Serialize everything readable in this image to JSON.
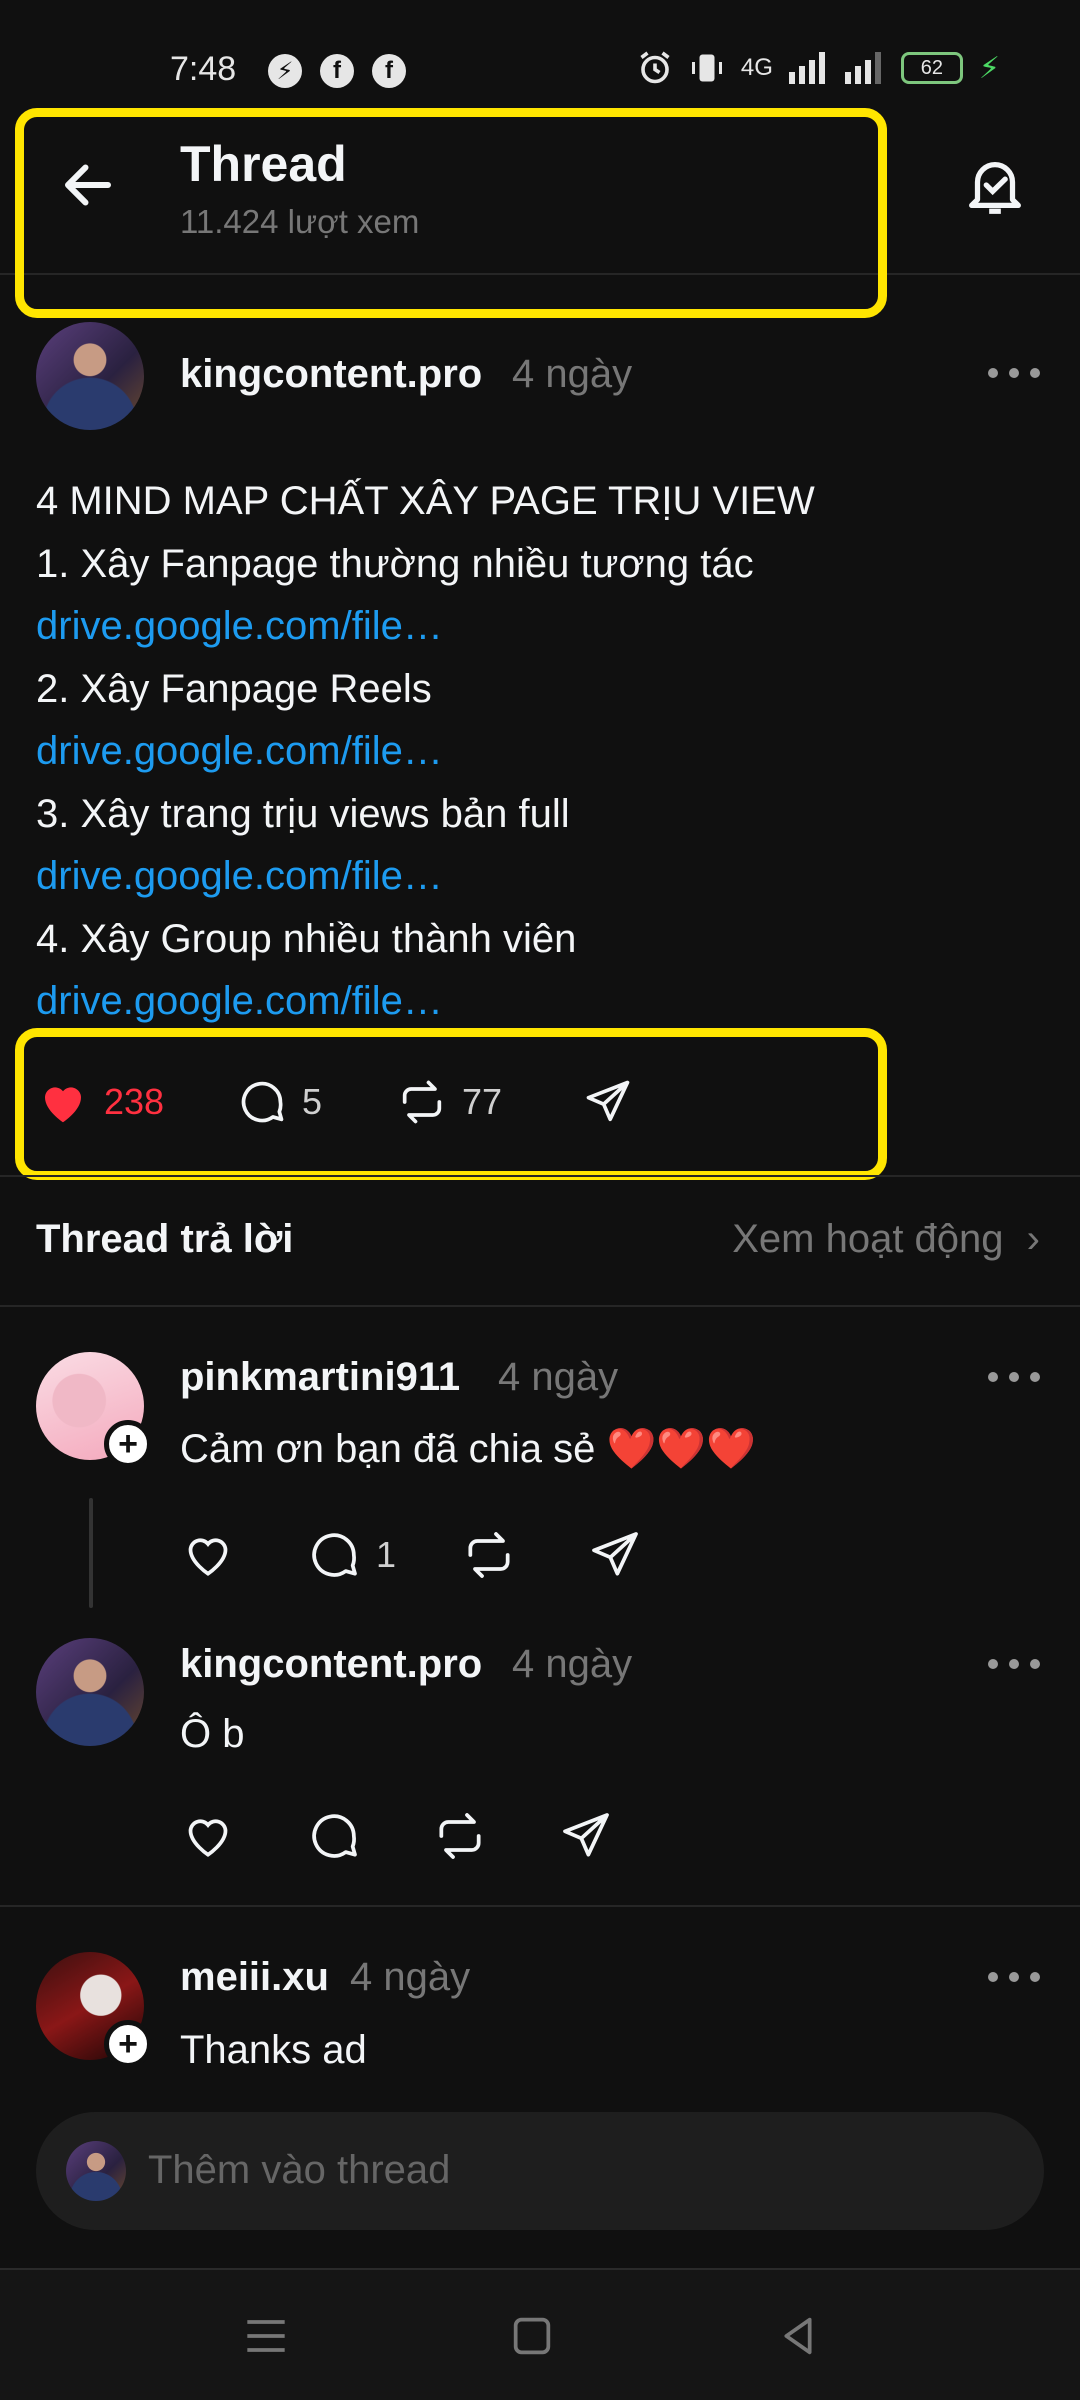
{
  "status_bar": {
    "time": "7:48",
    "left_icons": [
      "messenger-icon",
      "facebook-icon",
      "facebook-icon"
    ],
    "network_label": "4G",
    "battery": "62"
  },
  "header": {
    "title": "Thread",
    "subtitle": "11.424 lượt xem"
  },
  "post": {
    "username": "kingcontent.pro",
    "time": "4 ngày",
    "lines": [
      "4 MIND MAP CHẤT XÂY PAGE TRỊU VIEW",
      "1. Xây Fanpage thường nhiều tương tác",
      "drive.google.com/file…",
      "2. Xây Fanpage Reels",
      "drive.google.com/file…",
      "3. Xây trang trịu views bản full",
      "drive.google.com/file…",
      "4. Xây Group nhiều thành viên",
      "drive.google.com/file…"
    ],
    "likes": "238",
    "comments": "5",
    "reposts": "77"
  },
  "section": {
    "title": "Thread trả lời",
    "link": "Xem hoạt động"
  },
  "replies": [
    {
      "username": "pinkmartini911",
      "time": "4 ngày",
      "text": "Cảm ơn bạn đã chia sẻ",
      "emoji": "❤️❤️❤️",
      "comments": "1"
    },
    {
      "username": "kingcontent.pro",
      "time": "4 ngày",
      "text": "Ô b"
    },
    {
      "username": "meiii.xu",
      "time": "4 ngày",
      "text": "Thanks ad"
    }
  ],
  "composer": {
    "placeholder": "Thêm vào thread"
  },
  "colors": {
    "background": "#101010",
    "like": "#ff3040",
    "link": "#1d9bf0",
    "highlight": "#ffe500"
  }
}
